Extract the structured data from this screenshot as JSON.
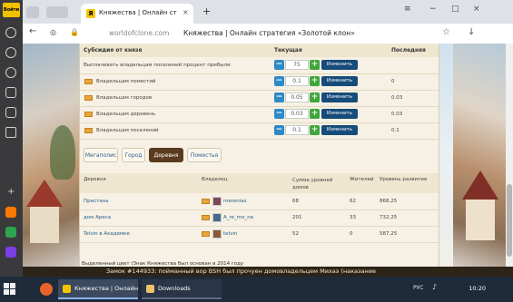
{
  "browser": {
    "user_badge": "Войти",
    "tab_title": "Княжества | Онлайн ст",
    "tab_favicon": "Я",
    "url": "worldofclone.com",
    "page_heading": "Княжества | Онлайн стратегия «Золотой клон»"
  },
  "subsidies": {
    "headers": [
      "Субсидия от князя",
      "Текущая",
      "Последняя"
    ],
    "change_label": "Изменить",
    "rows": [
      {
        "label": "Выплачивать владельцам поселений процент прибыли",
        "value": "75",
        "last": ""
      },
      {
        "label": "Владельцам поместий",
        "value": "0.1",
        "last": "0"
      },
      {
        "label": "Владельцам городов",
        "value": "0.05",
        "last": "0.03"
      },
      {
        "label": "Владельцам деревень",
        "value": "0.03",
        "last": "0.03"
      },
      {
        "label": "Владельцам поселений",
        "value": "0.1",
        "last": "0.1"
      }
    ]
  },
  "settlement_tabs": [
    "Мегаполис",
    "Город",
    "Деревня",
    "Поместья"
  ],
  "active_tab": "Деревня",
  "villages": {
    "headers": [
      "Деревня",
      "Владелец",
      "Сумма уровней домов",
      "Жителей",
      "Уровень развития"
    ],
    "rows": [
      {
        "name": "Пристань",
        "owner": "merenias",
        "levels": "68",
        "residents": "62",
        "development": "868,25"
      },
      {
        "name": "дом Ареса",
        "owner": "A_re_mo_ne",
        "levels": "201",
        "residents": "33",
        "development": "732,25"
      },
      {
        "name": "Telvin в Академке",
        "owner": "telvin",
        "levels": "52",
        "residents": "0",
        "development": "587,25"
      }
    ],
    "footnote": "Выделенный цвет (Знак Княжества был основан в 2014 году"
  },
  "ticker": "Замок #144933: пойманный вор  BSH был прочуен домовладельцем  Михаэ (наказание",
  "taskbar": {
    "task1": "Княжества | Онлайн...",
    "task2": "Downloads",
    "tray_lang": "РУС",
    "clock": "10:20"
  },
  "colors": {
    "accent": "#164b7a",
    "plus": "#3ea63a",
    "minus": "#2d8ac7",
    "active_tab": "#5a3b1f"
  }
}
